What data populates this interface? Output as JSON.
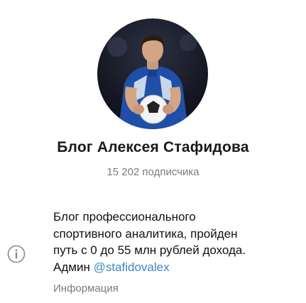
{
  "channel": {
    "title": "Блог Алексея Стафидова",
    "subscribers": "15 202 подписчика",
    "avatar_icon": "channel-avatar-photo"
  },
  "info": {
    "description_lines": [
      "Блог профессионального",
      "спортивного аналитика, пройден",
      "путь с 0 до 55 млн рублей дохода."
    ],
    "admin_prefix": "Админ ",
    "admin_link": "@stafidovalex",
    "label": "Информация",
    "icon": "info-icon"
  },
  "colors": {
    "link": "#3d86c6",
    "secondary_text": "#7b7b7b"
  }
}
